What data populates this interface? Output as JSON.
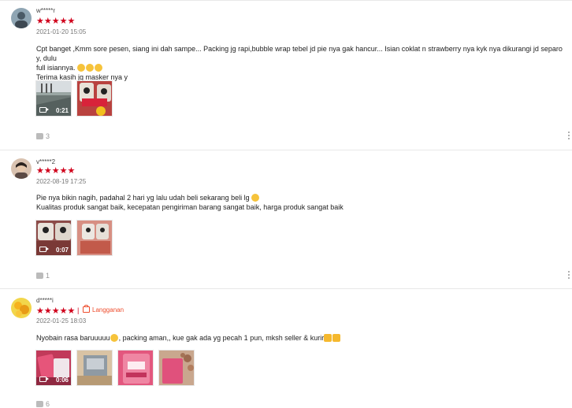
{
  "reviews": [
    {
      "username": "w*****r",
      "rating": 5,
      "stars_text": "★★★★★",
      "datetime": "2021-01-20 15:05",
      "comment_lines": [
        "Cpt banget ,Kmm sore pesen, siang ini dah sampe... Packing jg rapi,bubble wrap tebel jd pie nya gak hancur... Isian coklat n strawberry nya kyk nya dikurangi jd separo y, dulu",
        "full isiannya.",
        "Terima kasih jg masker nya y"
      ],
      "media": [
        {
          "type": "video",
          "duration": "0:21"
        },
        {
          "type": "image"
        }
      ],
      "likes": "3"
    },
    {
      "username": "v*****2",
      "rating": 5,
      "stars_text": "★★★★★",
      "datetime": "2022-08-19 17:25",
      "comment_lines": [
        "Pie nya bikin nagih, padahal 2 hari yg lalu udah beli sekarang beli lg",
        "Kualitas produk sangat baik, kecepatan pengiriman barang sangat baik, harga produk sangat baik"
      ],
      "media": [
        {
          "type": "video",
          "duration": "0:07"
        },
        {
          "type": "image"
        }
      ],
      "likes": "1"
    },
    {
      "username": "d*****i",
      "rating": 5,
      "stars_text": "★★★★★",
      "badge": "Langganan",
      "datetime": "2022-01-25 18:03",
      "comment_lines": [
        "Nyobain rasa baruuuuu",
        ", packing aman,, kue gak ada yg pecah 1 pun, mksh seller & kurir"
      ],
      "media": [
        {
          "type": "video",
          "duration": "0:06"
        },
        {
          "type": "image"
        },
        {
          "type": "image"
        },
        {
          "type": "image"
        }
      ],
      "likes": "6"
    }
  ],
  "colors": {
    "star": "#d0011b",
    "badge": "#ee4d2d",
    "muted": "#999999"
  },
  "icons": [
    "avatar",
    "star-icon",
    "video-camera-icon",
    "thumbs-up-icon",
    "more-options-icon",
    "emoji-icon",
    "member-bag-icon"
  ]
}
